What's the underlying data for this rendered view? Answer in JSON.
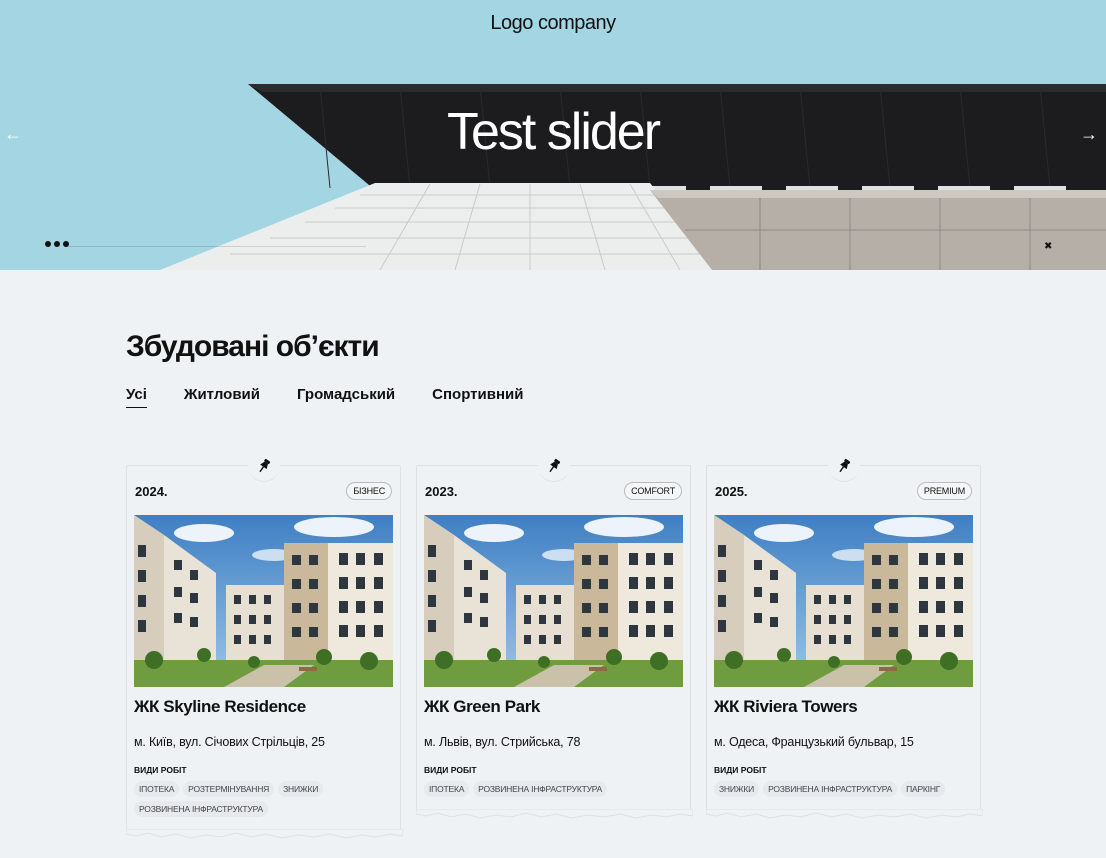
{
  "header": {
    "logo": "Logo company"
  },
  "hero": {
    "title": "Test slider",
    "prev_icon": "arrow-left-icon",
    "next_icon": "arrow-right-icon",
    "colors": {
      "sky": "#a3d5e3",
      "roof": "#1c1c1e"
    }
  },
  "section": {
    "title": "Збудовані об’єкти",
    "filters": [
      {
        "label": "Усі",
        "active": true
      },
      {
        "label": "Житловий",
        "active": false
      },
      {
        "label": "Громадський",
        "active": false
      },
      {
        "label": "Спортивний",
        "active": false
      }
    ]
  },
  "works_label": "Види робіт",
  "cards": [
    {
      "year": "2024.",
      "badge": "Бізнес",
      "name": "ЖК Skyline Residence",
      "address": "м. Київ, вул. Січових Стрільців, 25",
      "tags": [
        "Іпотека",
        "Розтермінування",
        "Знижки",
        "Розвинена інфраструктура"
      ]
    },
    {
      "year": "2023.",
      "badge": "Comfort",
      "name": "ЖК Green Park",
      "address": "м. Львів, вул. Стрийська, 78",
      "tags": [
        "Іпотека",
        "Розвинена інфраструктура"
      ]
    },
    {
      "year": "2025.",
      "badge": "Premium",
      "name": "ЖК Riviera Towers",
      "address": "м. Одеса, Французький бульвар, 15",
      "tags": [
        "Знижки",
        "Розвинена інфраструктура",
        "Паркінг"
      ]
    }
  ]
}
